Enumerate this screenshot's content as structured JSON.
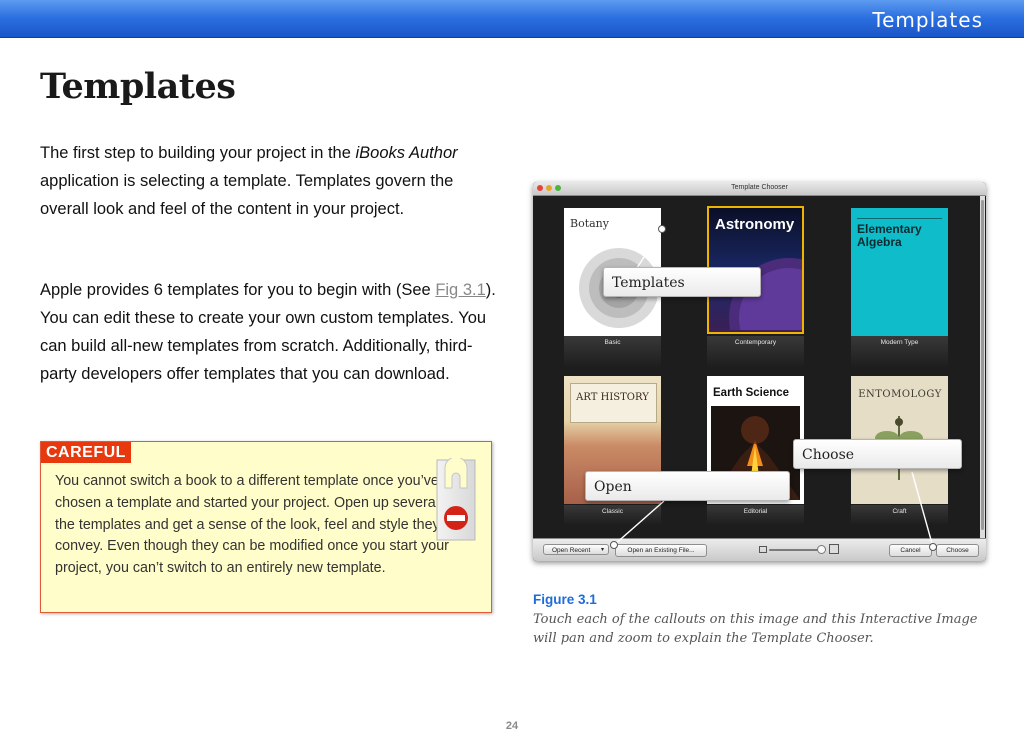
{
  "header": {
    "section_title": "Templates"
  },
  "page": {
    "title": "Templates",
    "para1": {
      "before": "The first step to building your project in the ",
      "italic": "iBooks Author",
      "after": " application is selecting a template. Templates govern the overall look and feel of the content in your project."
    },
    "para2": {
      "before": "Apple provides 6 templates for you to begin with (See ",
      "link": "Fig 3.1",
      "after": "). You can edit these to create your own custom templates. You can build all-new templates from scratch. Additionally, third-party developers offer templates that you can download."
    },
    "page_number": "24"
  },
  "careful": {
    "label": "CAREFUL",
    "text": "You cannot switch a book to a different template once you’ve chosen a template and started your project. Open up several of the templates and get a sense of the look, feel and style they convey. Even though they can be modified once you start your project, you can’t switch to an entirely new template.",
    "icon": "do-not-disturb-door-hanger-icon"
  },
  "figure": {
    "window_title": "Template Chooser",
    "templates": [
      {
        "label": "Basic",
        "cover_title": "Botany"
      },
      {
        "label": "Contemporary",
        "cover_title": "Astronomy"
      },
      {
        "label": "Modern Type",
        "cover_title": "Elementary Algebra"
      },
      {
        "label": "Classic",
        "cover_title": "ART HISTORY"
      },
      {
        "label": "Editorial",
        "cover_title": "Earth Science"
      },
      {
        "label": "Craft",
        "cover_title": "ENTOMOLOGY"
      }
    ],
    "bottom_buttons": {
      "open_recent": "Open Recent",
      "open_existing": "Open an Existing File...",
      "cancel": "Cancel",
      "choose": "Choose"
    },
    "callouts": {
      "templates": "Templates",
      "choose": "Choose",
      "open": "Open"
    },
    "caption_title": "Figure 3.1",
    "caption_text": "Touch each of the callouts on this image and this Interactive Image will pan and zoom to explain the Template Chooser.",
    "colors": {
      "selection": "#f0b400",
      "accent_blue": "#1e6cd8",
      "careful_red": "#e8380d"
    }
  }
}
